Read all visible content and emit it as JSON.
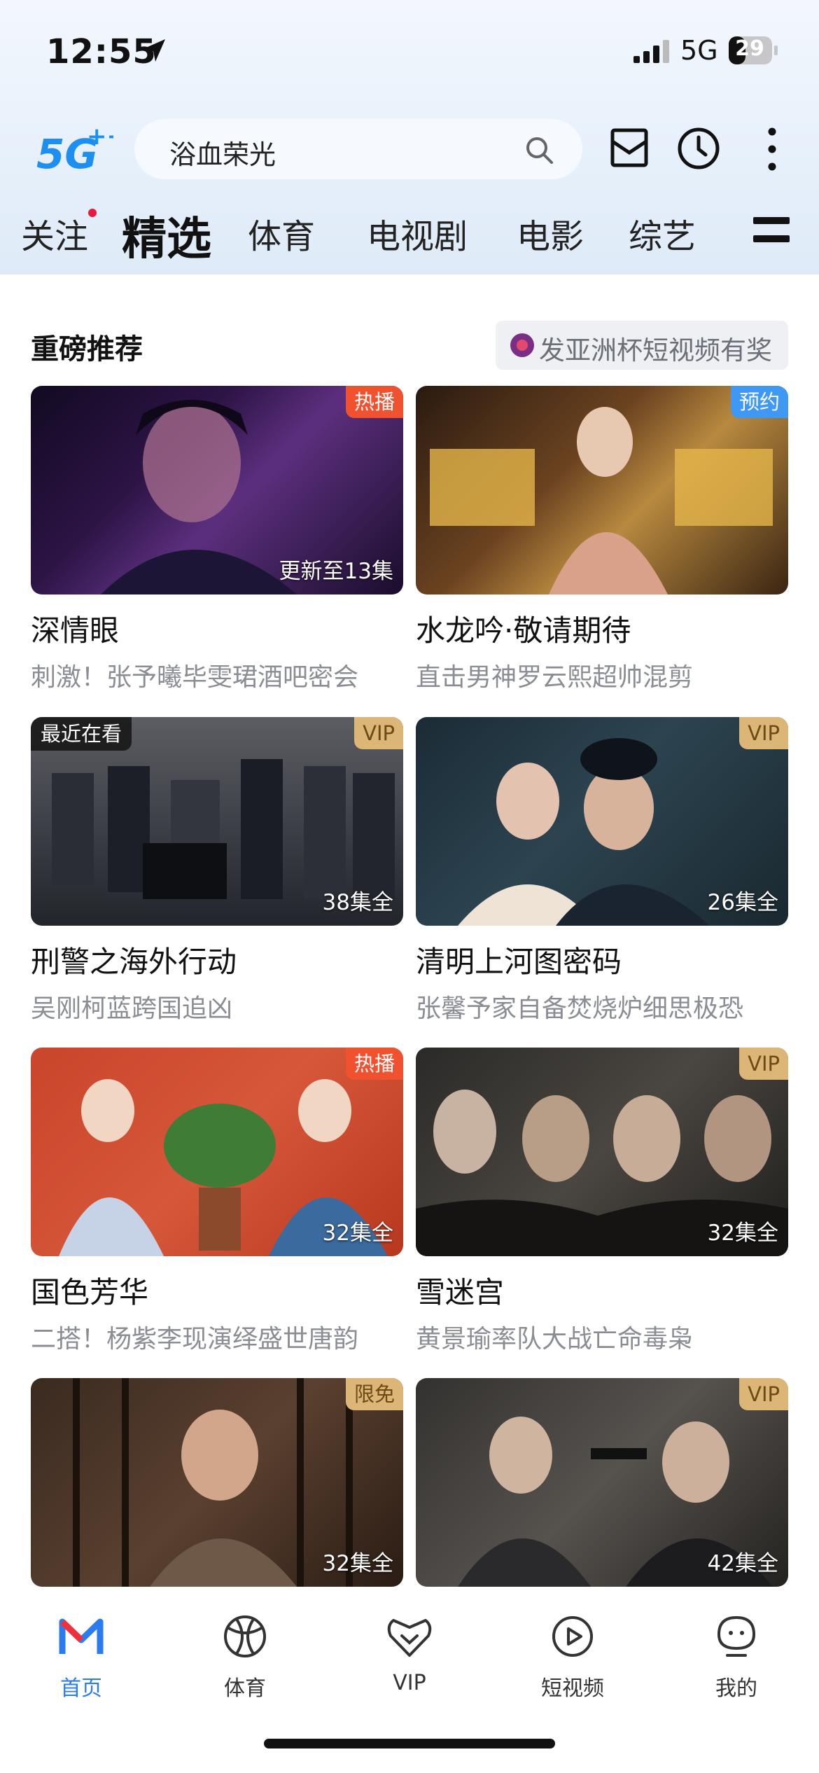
{
  "status_bar": {
    "time": "12:55",
    "network": "5G",
    "battery": "29"
  },
  "header": {
    "search_text": "浴血荣光"
  },
  "tabs": [
    {
      "label": "关注"
    },
    {
      "label": "精选"
    },
    {
      "label": "体育"
    },
    {
      "label": "电视剧"
    },
    {
      "label": "电影"
    },
    {
      "label": "综艺"
    }
  ],
  "section": {
    "title": "重磅推荐",
    "promo": "发亚洲杯短视频有奖"
  },
  "cards": [
    {
      "title": "深情眼",
      "subtitle": "刺激！张予曦毕雯珺酒吧密会",
      "badge": "热播",
      "episodes": "更新至13集",
      "recent": ""
    },
    {
      "title": "水龙吟·敬请期待",
      "subtitle": "直击男神罗云熙超帅混剪",
      "badge": "预约",
      "episodes": "",
      "recent": ""
    },
    {
      "title": "刑警之海外行动",
      "subtitle": "吴刚柯蓝跨国追凶",
      "badge": "VIP",
      "episodes": "38集全",
      "recent": "最近在看"
    },
    {
      "title": "清明上河图密码",
      "subtitle": "张馨予家自备焚烧炉细思极恐",
      "badge": "VIP",
      "episodes": "26集全",
      "recent": ""
    },
    {
      "title": "国色芳华",
      "subtitle": "二搭！杨紫李现演绎盛世唐韵",
      "badge": "热播",
      "episodes": "32集全",
      "recent": ""
    },
    {
      "title": "雪迷宫",
      "subtitle": "黄景瑜率队大战亡命毒枭",
      "badge": "VIP",
      "episodes": "32集全",
      "recent": ""
    },
    {
      "title": "",
      "subtitle": "",
      "badge": "限免",
      "episodes": "32集全",
      "recent": ""
    },
    {
      "title": "",
      "subtitle": "",
      "badge": "VIP",
      "episodes": "42集全",
      "recent": ""
    }
  ],
  "bottom_nav": [
    {
      "label": "首页",
      "icon": "home-m-icon"
    },
    {
      "label": "体育",
      "icon": "basketball-icon"
    },
    {
      "label": "VIP",
      "icon": "vip-heart-icon"
    },
    {
      "label": "短视频",
      "icon": "play-circle-icon"
    },
    {
      "label": "我的",
      "icon": "profile-icon"
    }
  ],
  "colors": {
    "accent": "#2a7cf0",
    "hot_badge": "#f0512e",
    "vip_badge": "#dbb677",
    "preorder_badge": "#3e98f4",
    "dot": "#e8193b"
  }
}
